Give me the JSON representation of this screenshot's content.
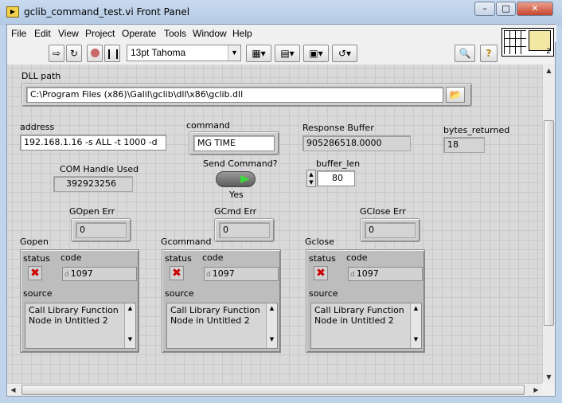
{
  "window": {
    "title": "gclib_command_test.vi Front Panel",
    "minimize": "–",
    "maximize": "□",
    "close": "✕"
  },
  "menu": [
    "File",
    "Edit",
    "View",
    "Project",
    "Operate",
    "Tools",
    "Window",
    "Help"
  ],
  "toolbar": {
    "font": "13pt Tahoma",
    "help": "?",
    "connector_number": "2"
  },
  "dll_path": {
    "label": "DLL path",
    "value": "C:\\Program Files (x86)\\Galil\\gclib\\dll\\x86\\gclib.dll"
  },
  "address": {
    "label": "address",
    "value": "192.168.1.16  -s ALL -t 1000 -d"
  },
  "command": {
    "label": "command",
    "value": "MG TIME"
  },
  "response_buffer": {
    "label": "Response Buffer",
    "value": "905286518.0000"
  },
  "bytes_returned": {
    "label": "bytes_returned",
    "value": "18"
  },
  "com_handle": {
    "label": "COM Handle Used",
    "value": "392923256"
  },
  "send_command": {
    "label": "Send Command?",
    "state_text": "Yes"
  },
  "buffer_len": {
    "label": "buffer_len",
    "value": "80"
  },
  "errors": {
    "gopen_err": {
      "label": "GOpen Err",
      "value": "0"
    },
    "gcmd_err": {
      "label": "GCmd Err",
      "value": "0"
    },
    "gclose_err": {
      "label": "GClose Err",
      "value": "0"
    }
  },
  "clusters": [
    {
      "label": "Gopen",
      "status_label": "status",
      "code_label": "code",
      "code": "1097",
      "source_label": "source",
      "source": "Call Library Function Node in Untitled 2"
    },
    {
      "label": "Gcommand",
      "status_label": "status",
      "code_label": "code",
      "code": "1097",
      "source_label": "source",
      "source": "Call Library Function Node in Untitled 2"
    },
    {
      "label": "Gclose",
      "status_label": "status",
      "code_label": "code",
      "code": "1097",
      "source_label": "source",
      "source": "Call Library Function Node in Untitled 2"
    }
  ],
  "colors": {
    "led_green": "#3cd83c",
    "error_x": "#cc0000"
  },
  "icons": {
    "run": "run-arrow-icon",
    "run_continuous": "run-continuous-icon",
    "abort": "abort-icon",
    "pause": "pause-icon",
    "search": "search-icon",
    "folder": "browse-folder-icon"
  }
}
